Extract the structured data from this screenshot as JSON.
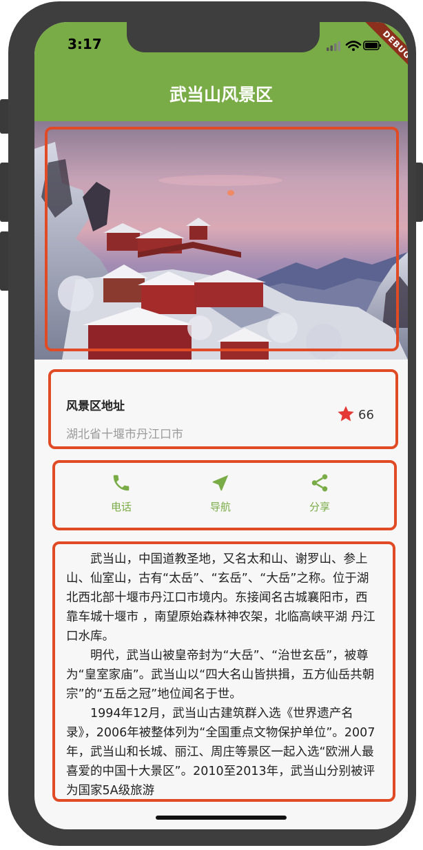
{
  "status_bar": {
    "time": "3:17",
    "icons": [
      "signal-icon",
      "wifi-icon",
      "battery-icon"
    ]
  },
  "debug_banner": "DEBUG",
  "app_bar": {
    "title": "武当山风景区",
    "color": "#79ac46"
  },
  "hero": {
    "image": "wudang-mountain-snow-temples"
  },
  "address": {
    "title": "风景区地址",
    "subtitle": "湖北省十堰市丹江口市",
    "favorite_icon": "star-icon",
    "favorite_count": "66"
  },
  "actions": [
    {
      "icon": "phone-icon",
      "label": "电话"
    },
    {
      "icon": "navigation-icon",
      "label": "导航"
    },
    {
      "icon": "share-icon",
      "label": "分享"
    }
  ],
  "description": {
    "paragraphs": [
      "武当山，中国道教圣地，又名太和山、谢罗山、参上山、仙室山，古有“太岳”、“玄岳”、“大岳”之称。位于湖北西北部十堰市丹江口市境内。东接闻名古城襄阳市，西靠车城十堰市 ，南望原始森林神农架，北临高峡平湖 丹江口水库。",
      "明代，武当山被皇帝封为“大岳”、“治世玄岳”，被尊为“皇室家庙”。武当山以“四大名山皆拱揖，五方仙岳共朝宗”的“五岳之冠”地位闻名于世。",
      "1994年12月，武当山古建筑群入选《世界遗产名录》，2006年被整体列为“全国重点文物保护单位”。2007年，武当山和长城、丽江、周庄等景区一起入选“欧洲人最喜爱的中国十大景区”。2010至2013年，武当山分别被评为国家5A级旅游"
    ]
  },
  "colors": {
    "accent": "#79ac46",
    "highlight": "#e04b26",
    "star": "#e53935"
  }
}
